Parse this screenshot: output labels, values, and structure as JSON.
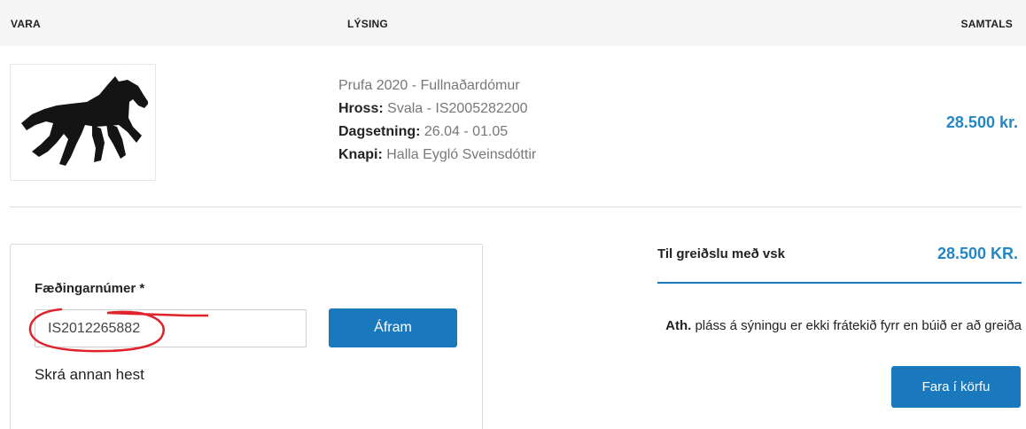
{
  "table_header": {
    "vara": "VARA",
    "lysing": "LÝSING",
    "samtals": "SAMTALS"
  },
  "item": {
    "image_icon": "horse-silhouette-icon",
    "title": "Prufa 2020 - Fullnaðardómur",
    "hross_label": "Hross:",
    "hross_value": "Svala - IS2005282200",
    "dagsetning_label": "Dagsetning:",
    "dagsetning_value": "26.04 - 01.05",
    "knapi_label": "Knapi:",
    "knapi_value": "Halla Eygló Sveinsdóttir",
    "price": "28.500 kr."
  },
  "form": {
    "label": "Fæðingarnúmer *",
    "input_value": "IS2012265882",
    "submit_label": "Áfram",
    "other_horse_link": "Skrá annan hest"
  },
  "summary": {
    "total_label": "Til greiðslu með vsk",
    "total_value": "28.500 KR.",
    "note_bold": "Ath.",
    "note_text": " pláss á sýningu er ekki frátekið fyrr en búið er að greiða",
    "cart_button": "Fara í körfu"
  },
  "colors": {
    "accent_blue": "#1a79bd",
    "price_blue": "#2487c3",
    "annotation_red": "#e0222a"
  }
}
